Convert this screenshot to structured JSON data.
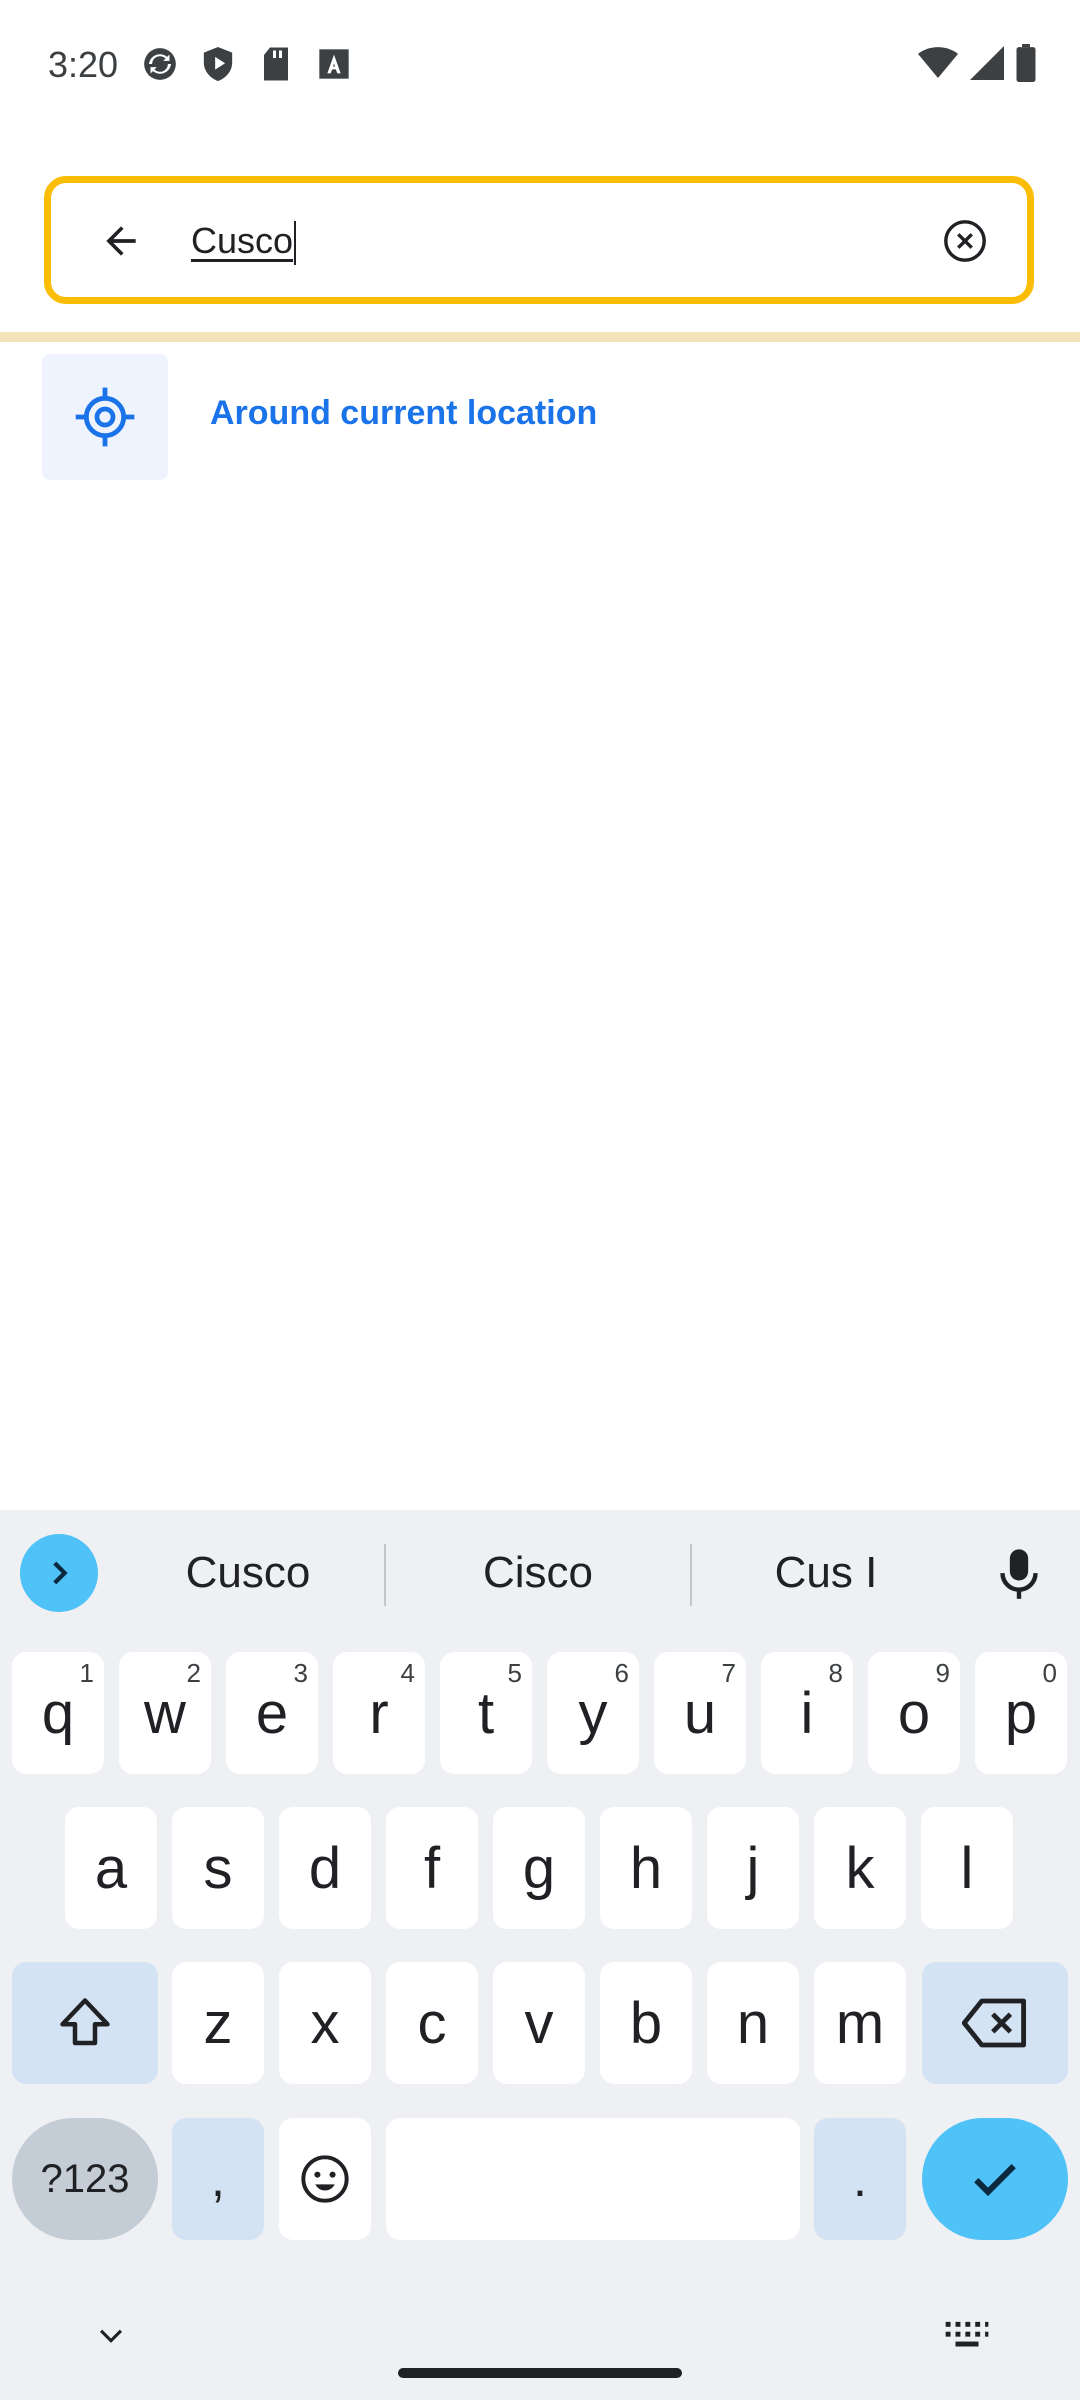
{
  "status_bar": {
    "time": "3:20",
    "left_icons": [
      "sync-icon",
      "shield-play-icon",
      "sd-card-icon",
      "font-a-icon"
    ],
    "right_icons": [
      "wifi-icon",
      "cell-signal-icon",
      "battery-icon"
    ]
  },
  "search": {
    "value": "Cusco",
    "back_icon": "arrow-back-icon",
    "clear_icon": "clear-circle-icon",
    "border_color": "#fbbc04"
  },
  "location_suggestion": {
    "label": "Around current location",
    "icon": "gps-target-icon",
    "color": "#1a73e8"
  },
  "keyboard": {
    "suggestions": [
      "Cusco",
      "Cisco",
      "Cus I"
    ],
    "row1": [
      {
        "k": "q",
        "h": "1"
      },
      {
        "k": "w",
        "h": "2"
      },
      {
        "k": "e",
        "h": "3"
      },
      {
        "k": "r",
        "h": "4"
      },
      {
        "k": "t",
        "h": "5"
      },
      {
        "k": "y",
        "h": "6"
      },
      {
        "k": "u",
        "h": "7"
      },
      {
        "k": "i",
        "h": "8"
      },
      {
        "k": "o",
        "h": "9"
      },
      {
        "k": "p",
        "h": "0"
      }
    ],
    "row2": [
      "a",
      "s",
      "d",
      "f",
      "g",
      "h",
      "j",
      "k",
      "l"
    ],
    "row3": [
      "z",
      "x",
      "c",
      "v",
      "b",
      "n",
      "m"
    ],
    "symbols_label": "?123",
    "comma_label": ",",
    "period_label": ".",
    "accent_color": "#4fc3f7"
  }
}
